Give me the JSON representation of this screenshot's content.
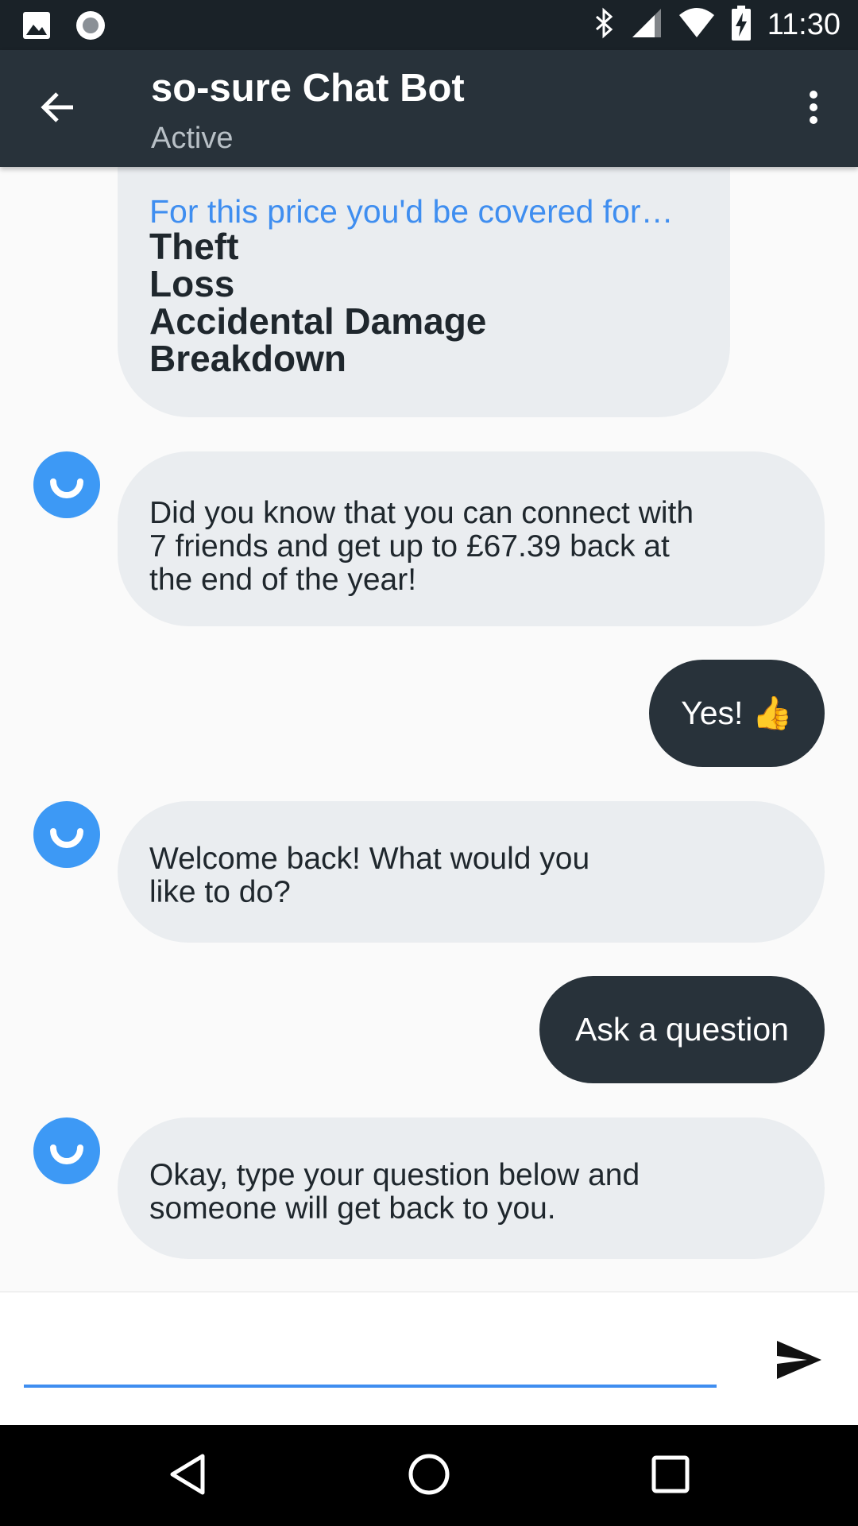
{
  "status_bar": {
    "time": "11:30",
    "icons": [
      "image-icon",
      "record-icon",
      "bluetooth-icon",
      "signal-icon",
      "wifi-icon",
      "battery-charging-icon"
    ]
  },
  "app_bar": {
    "title": "so-sure Chat Bot",
    "subtitle": "Active",
    "back_icon": "arrow-back-icon",
    "menu_icon": "more-vert-icon"
  },
  "messages": [
    {
      "sender": "bot",
      "title": "For this price you'd be covered for…",
      "items": [
        "Theft",
        "Loss",
        "Accidental Damage",
        "Breakdown"
      ]
    },
    {
      "sender": "bot",
      "lines": [
        "Did you know that you can connect with",
        "7 friends and get up to £67.39 back at",
        "the end of the year!"
      ]
    },
    {
      "sender": "user",
      "text": "Yes! 👍"
    },
    {
      "sender": "bot",
      "lines": [
        "Welcome back! What would you",
        "like to do?"
      ]
    },
    {
      "sender": "user",
      "text": "Ask a question"
    },
    {
      "sender": "bot",
      "lines": [
        "Okay, type your question below and",
        "someone will get back to you."
      ]
    }
  ],
  "input": {
    "value": "",
    "placeholder": "",
    "send_icon": "send-icon"
  },
  "nav_bar": {
    "icons": [
      "nav-back-icon",
      "nav-home-icon",
      "nav-recents-icon"
    ]
  },
  "colors": {
    "status_bar": "#1a2228",
    "app_bar": "#28323a",
    "bot_bubble": "#eaedf0",
    "user_bubble": "#28323a",
    "accent": "#3f8ef0",
    "avatar": "#3d99f5"
  }
}
